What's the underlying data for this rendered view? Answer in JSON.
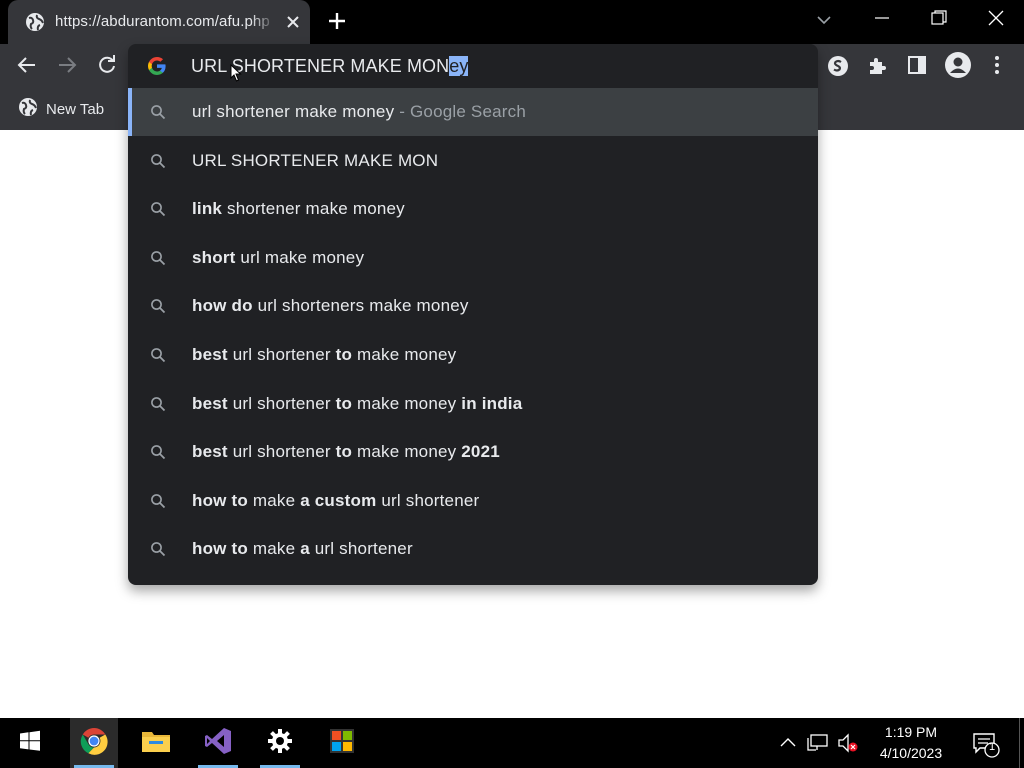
{
  "window": {
    "tab_title": "https://abdurantom.com/afu.php",
    "new_tab_button": "+",
    "controls": [
      "tab-search",
      "minimize",
      "maximize",
      "close"
    ]
  },
  "toolbar": {
    "omnibox_text_typed": "URL SHORTENER MAKE MON",
    "omnibox_text_autocomplete": "ey"
  },
  "bookmarks": {
    "items": [
      {
        "label": "New Tab"
      }
    ]
  },
  "suggestions": [
    {
      "parts": [
        {
          "t": "url shortener make money",
          "b": false
        }
      ],
      "suffix": " - Google Search",
      "selected": true
    },
    {
      "parts": [
        {
          "t": "URL SHORTENER MAKE MON",
          "b": false
        }
      ]
    },
    {
      "parts": [
        {
          "t": "link",
          "b": true
        },
        {
          "t": " shortener make money",
          "b": false
        }
      ]
    },
    {
      "parts": [
        {
          "t": "short",
          "b": true
        },
        {
          "t": " url make money",
          "b": false
        }
      ]
    },
    {
      "parts": [
        {
          "t": "how do",
          "b": true
        },
        {
          "t": " url shorteners make money",
          "b": false
        }
      ]
    },
    {
      "parts": [
        {
          "t": "best",
          "b": true
        },
        {
          "t": " url shortener ",
          "b": false
        },
        {
          "t": "to",
          "b": true
        },
        {
          "t": " make money",
          "b": false
        }
      ]
    },
    {
      "parts": [
        {
          "t": "best",
          "b": true
        },
        {
          "t": " url shortener ",
          "b": false
        },
        {
          "t": "to",
          "b": true
        },
        {
          "t": " make money ",
          "b": false
        },
        {
          "t": "in india",
          "b": true
        }
      ]
    },
    {
      "parts": [
        {
          "t": "best",
          "b": true
        },
        {
          "t": " url shortener ",
          "b": false
        },
        {
          "t": "to",
          "b": true
        },
        {
          "t": " make money ",
          "b": false
        },
        {
          "t": "2021",
          "b": true
        }
      ]
    },
    {
      "parts": [
        {
          "t": "how to",
          "b": true
        },
        {
          "t": " make ",
          "b": false
        },
        {
          "t": "a custom",
          "b": true
        },
        {
          "t": " url shortener",
          "b": false
        }
      ]
    },
    {
      "parts": [
        {
          "t": "how to",
          "b": true
        },
        {
          "t": " make ",
          "b": false
        },
        {
          "t": "a",
          "b": true
        },
        {
          "t": " url shortener",
          "b": false
        }
      ]
    }
  ],
  "taskbar": {
    "apps": [
      "start",
      "chrome",
      "file-explorer",
      "visual-studio",
      "settings",
      "microsoft-store"
    ],
    "time": "1:19 PM",
    "date": "4/10/2023",
    "notification_count": "1"
  },
  "colors": {
    "tab_bg": "#35363a",
    "popup_bg": "#202124",
    "selected_row_bg": "#3c4043",
    "accent": "#8ab4f8",
    "text": "#e8eaed",
    "muted": "#9aa0a6"
  }
}
